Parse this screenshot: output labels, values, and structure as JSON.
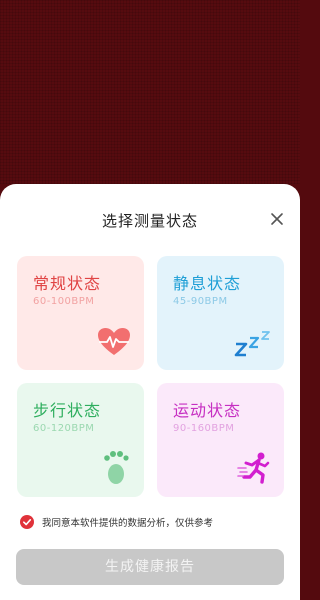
{
  "sheet": {
    "title": "选择测量状态",
    "close_icon": "close-icon"
  },
  "cards": [
    {
      "name": "常规状态",
      "range": "60-100BPM",
      "icon": "heart-pulse-icon",
      "color": "#e04444",
      "bg": "#ffe9e8"
    },
    {
      "name": "静息状态",
      "range": "45-90BPM",
      "icon": "sleep-zzz-icon",
      "color": "#1f9fd6",
      "bg": "#e3f3fb"
    },
    {
      "name": "步行状态",
      "range": "60-120BPM",
      "icon": "footprint-icon",
      "color": "#2eae5e",
      "bg": "#e9f8ee"
    },
    {
      "name": "运动状态",
      "range": "90-160BPM",
      "icon": "running-icon",
      "color": "#c62fc2",
      "bg": "#fbe9fa"
    }
  ],
  "agreement": {
    "checked": true,
    "text": "我同意本软件提供的数据分析，仅供参考"
  },
  "generate_button": {
    "label": "生成健康报告",
    "enabled": false
  }
}
